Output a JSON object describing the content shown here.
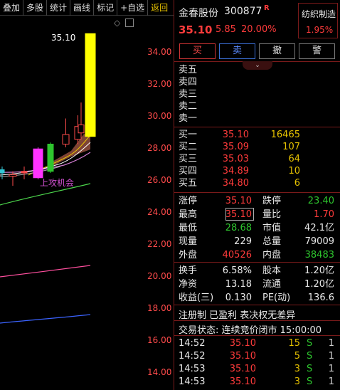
{
  "toolbar": {
    "items": [
      "叠加",
      "多股",
      "统计",
      "画线",
      "标记",
      "+自选",
      "返回"
    ]
  },
  "chart_data": {
    "type": "candlestick",
    "y_ticks": [
      "34.00",
      "32.00",
      "30.00",
      "28.00",
      "26.00",
      "24.00",
      "22.00",
      "20.00",
      "18.00",
      "16.00",
      "14.00"
    ],
    "high_label": "35.10",
    "annotation": "上攻机会",
    "candles": [
      {
        "open": 26.6,
        "close": 26.4,
        "high": 26.8,
        "low": 26.0,
        "color": "cyan"
      },
      {
        "open": 26.3,
        "close": 26.2,
        "high": 26.5,
        "low": 25.6,
        "color": "black"
      },
      {
        "open": 26.5,
        "close": 26.4,
        "high": 26.8,
        "low": 26.0,
        "color": "red"
      },
      {
        "open": 26.1,
        "close": 27.9,
        "high": 28.0,
        "low": 26.0,
        "color": "magenta"
      },
      {
        "open": 26.5,
        "close": 28.2,
        "high": 28.3,
        "low": 26.4,
        "color": "green"
      },
      {
        "open": 28.2,
        "close": 28.8,
        "high": 29.8,
        "low": 28.0,
        "color": "black"
      },
      {
        "open": 28.5,
        "close": 29.3,
        "high": 30.0,
        "low": 28.2,
        "color": "black"
      },
      {
        "open": 28.9,
        "close": 29.4,
        "high": 30.8,
        "low": 28.6,
        "color": "black"
      },
      {
        "open": 28.68,
        "close": 35.1,
        "high": 35.1,
        "low": 28.68,
        "color": "yellow"
      }
    ]
  },
  "stock": {
    "name": "金春股份",
    "code": "300877",
    "badge": "R",
    "sector": "纺织制造",
    "sector_change": "1.95%",
    "price": "35.10",
    "change": "5.85",
    "change_pct": "20.00%"
  },
  "trade_buttons": [
    "买",
    "卖",
    "撤",
    "警"
  ],
  "sell_book": [
    {
      "label": "卖五",
      "price": "",
      "vol": ""
    },
    {
      "label": "卖四",
      "price": "",
      "vol": ""
    },
    {
      "label": "卖三",
      "price": "",
      "vol": ""
    },
    {
      "label": "卖二",
      "price": "",
      "vol": ""
    },
    {
      "label": "卖一",
      "price": "",
      "vol": ""
    }
  ],
  "buy_book": [
    {
      "label": "买一",
      "price": "35.10",
      "vol": "16465"
    },
    {
      "label": "买二",
      "price": "35.09",
      "vol": "107"
    },
    {
      "label": "买三",
      "price": "35.03",
      "vol": "64"
    },
    {
      "label": "买四",
      "price": "34.89",
      "vol": "10"
    },
    {
      "label": "买五",
      "price": "34.80",
      "vol": "6"
    }
  ],
  "stats": [
    {
      "l1": "涨停",
      "v1": "35.10",
      "c1": "red",
      "l2": "跌停",
      "v2": "23.40",
      "c2": "green"
    },
    {
      "l1": "最高",
      "v1": "35.10",
      "c1": "red",
      "l2": "量比",
      "v2": "1.70",
      "c2": "red"
    },
    {
      "l1": "最低",
      "v1": "28.68",
      "c1": "green",
      "l2": "市值",
      "v2": "42.1亿",
      "c2": "white"
    },
    {
      "l1": "现量",
      "v1": "229",
      "c1": "white",
      "l2": "总量",
      "v2": "79009",
      "c2": "white"
    },
    {
      "l1": "外盘",
      "v1": "40526",
      "c1": "red",
      "l2": "内盘",
      "v2": "38483",
      "c2": "green"
    }
  ],
  "stats2": [
    {
      "l1": "换手",
      "v1": "6.58%",
      "l2": "股本",
      "v2": "1.20亿"
    },
    {
      "l1": "净资",
      "v1": "13.18",
      "l2": "流通",
      "v2": "1.20亿"
    },
    {
      "l1": "收益(三)",
      "v1": "0.130",
      "l2": "PE(动)",
      "v2": "136.6"
    }
  ],
  "notice": "注册制 已盈利 表决权无差异",
  "trade_status": "交易状态: 连续竞价闭市 15:00:00",
  "ticks": [
    {
      "time": "14:52",
      "price": "35.10",
      "vol": "15",
      "side": "S",
      "n": "1"
    },
    {
      "time": "14:52",
      "price": "35.10",
      "vol": "5",
      "side": "S",
      "n": "1"
    },
    {
      "time": "14:53",
      "price": "35.10",
      "vol": "3",
      "side": "S",
      "n": "1"
    },
    {
      "time": "14:53",
      "price": "35.10",
      "vol": "3",
      "side": "S",
      "n": "1"
    }
  ]
}
